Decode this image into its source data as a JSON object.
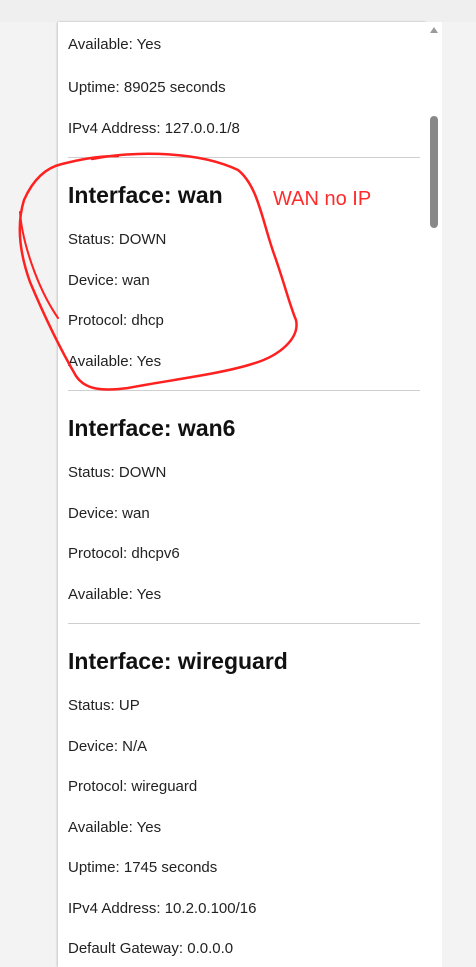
{
  "interfaces": [
    {
      "lines": [
        "Available: Yes",
        "Uptime: 89025 seconds",
        "IPv4 Address: 127.0.0.1/8"
      ]
    },
    {
      "title": "Interface: wan",
      "lines": [
        "Status: DOWN",
        "Device: wan",
        "Protocol: dhcp",
        "Available: Yes"
      ]
    },
    {
      "title": "Interface: wan6",
      "lines": [
        "Status: DOWN",
        "Device: wan",
        "Protocol: dhcpv6",
        "Available: Yes"
      ]
    },
    {
      "title": "Interface: wireguard",
      "lines": [
        "Status: UP",
        "Device: N/A",
        "Protocol: wireguard",
        "Available: Yes",
        "Uptime: 1745 seconds",
        "IPv4 Address: 10.2.0.100/16",
        "Default Gateway: 0.0.0.0"
      ]
    }
  ],
  "annotation": {
    "text": "WAN no IP",
    "color": "#ff2a2a"
  }
}
